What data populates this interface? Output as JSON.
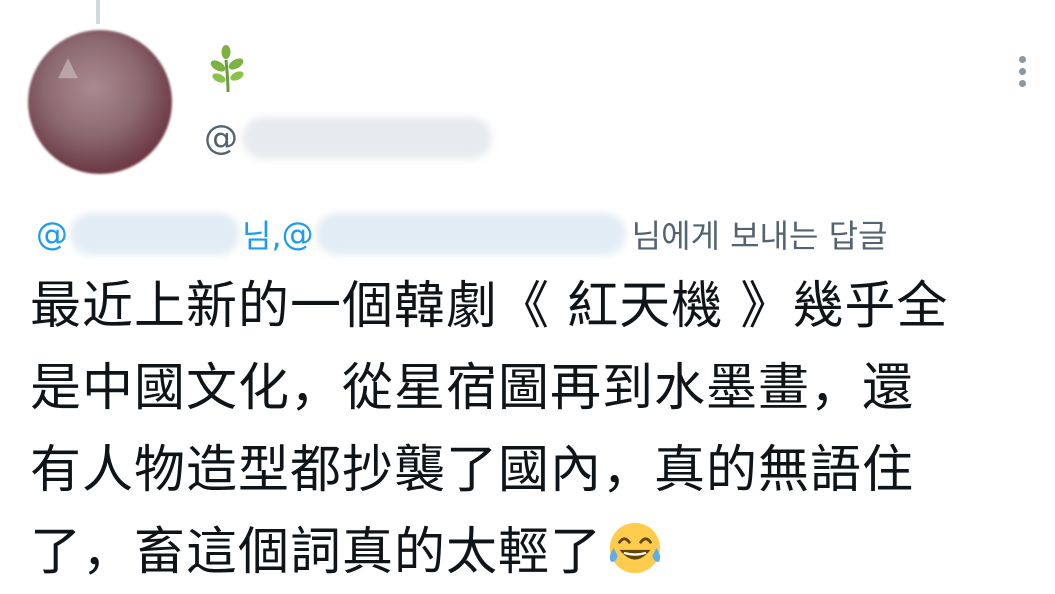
{
  "author": {
    "avatar": "blurred-avatar",
    "display_name_icon": "sprout-icon",
    "handle_prefix": "@"
  },
  "reply_context": {
    "at1": "@",
    "suffix1": "님, ",
    "at2": "@",
    "suffix2": "님에게 보내는 답글"
  },
  "tweet": {
    "line1": "最近上新的一個韓劇《 紅天機 》幾乎全",
    "line2": "是中國文化，從星宿圖再到水墨畫，還",
    "line3": "有人物造型都抄襲了國內，真的無語住",
    "line4": "了，畜這個詞真的太輕了",
    "trailing_emoji": "tears-of-joy-emoji"
  },
  "menu": {
    "icon": "more-vertical-icon"
  },
  "colors": {
    "link": "#1d9bf0",
    "secondary": "#536471",
    "text": "#0f1419"
  }
}
